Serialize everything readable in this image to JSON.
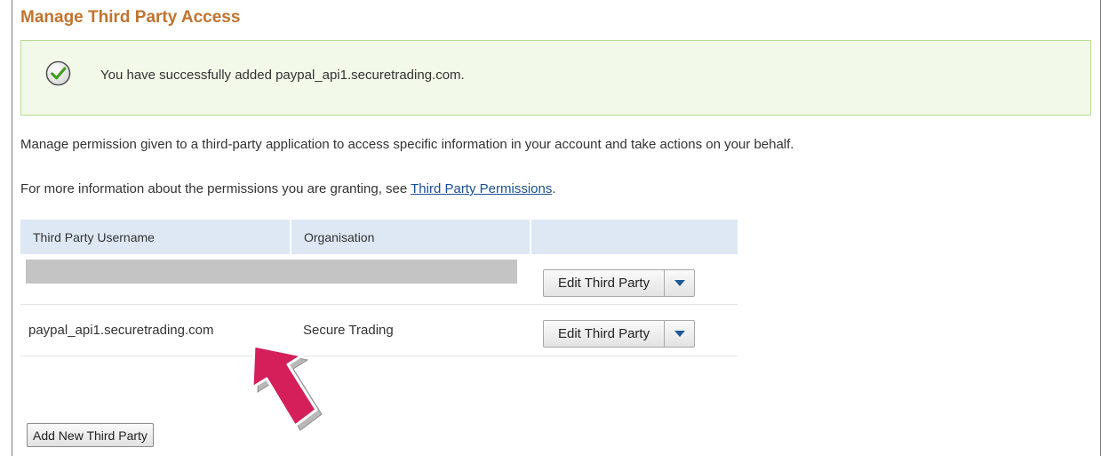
{
  "page": {
    "title": "Manage Third Party Access"
  },
  "success": {
    "message": "You have successfully added paypal_api1.securetrading.com.",
    "icon": "check-circle-icon"
  },
  "description": "Manage permission given to a third-party application to access specific information in your account and take actions on your behalf.",
  "info": {
    "prefix": "For more information about the permissions you are granting, see ",
    "link": "Third Party Permissions",
    "suffix": "."
  },
  "table": {
    "headers": [
      "Third Party Username",
      "Organisation",
      ""
    ],
    "rows": [
      {
        "username": "",
        "organisation": "",
        "redacted": true,
        "action": "Edit Third Party"
      },
      {
        "username": "paypal_api1.securetrading.com",
        "organisation": "Secure Trading",
        "redacted": false,
        "action": "Edit Third Party"
      }
    ]
  },
  "add_button": "Add New Third Party",
  "colors": {
    "title": "#c0732f",
    "success_bg": "#f2f9e9",
    "success_border": "#b6db90",
    "link": "#1a4f94",
    "header_bg": "#dde8f4",
    "annotation_arrow": "#d41f5b"
  }
}
